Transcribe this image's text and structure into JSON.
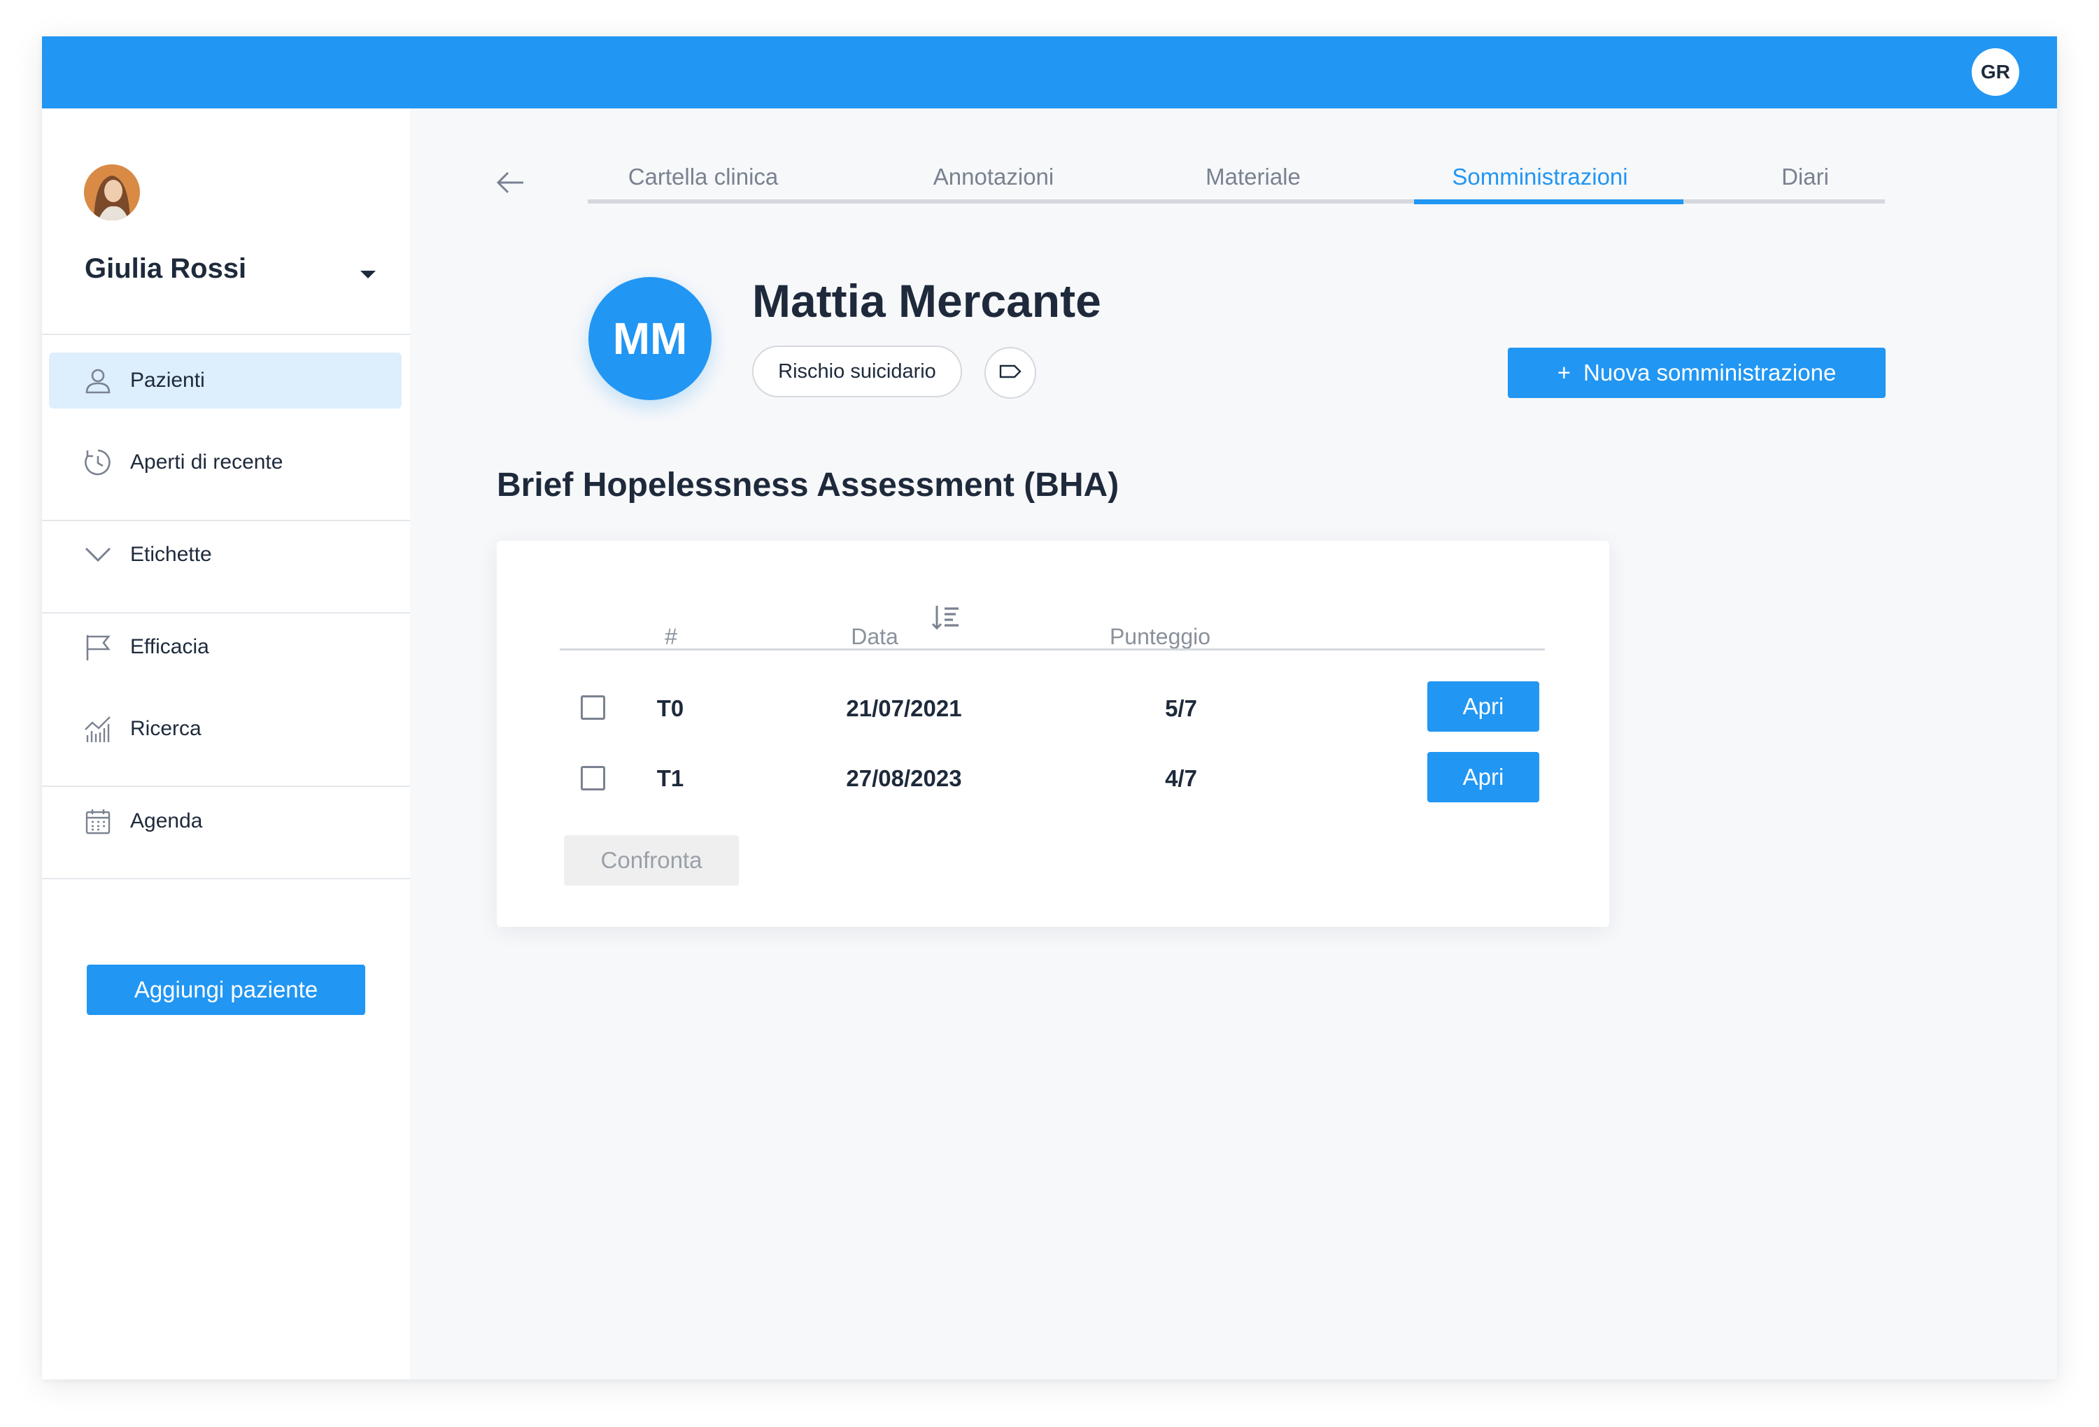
{
  "header": {
    "user_initials": "GR",
    "bar_color": "#2196f3"
  },
  "sidebar": {
    "user_name": "Giulia Rossi",
    "items": [
      {
        "label": "Pazienti",
        "icon": "user-icon",
        "active": true
      },
      {
        "label": "Aperti di recente",
        "icon": "history-icon",
        "active": false
      },
      {
        "label": "Etichette",
        "icon": "chevron-down-icon",
        "active": false
      },
      {
        "label": "Efficacia",
        "icon": "flag-icon",
        "active": false
      },
      {
        "label": "Ricerca",
        "icon": "chart-icon",
        "active": false
      },
      {
        "label": "Agenda",
        "icon": "calendar-icon",
        "active": false
      }
    ],
    "add_patient_label": "Aggiungi paziente"
  },
  "tabs": [
    {
      "label": "Cartella clinica",
      "active": false
    },
    {
      "label": "Annotazioni",
      "active": false
    },
    {
      "label": "Materiale",
      "active": false
    },
    {
      "label": "Somministrazioni",
      "active": true
    },
    {
      "label": "Diari",
      "active": false
    }
  ],
  "patient": {
    "initials": "MM",
    "name": "Mattia Mercante",
    "tag": "Rischio suicidario"
  },
  "actions": {
    "new_admin_plus": "+",
    "new_admin_label": "Nuova somministrazione"
  },
  "assessment": {
    "title": "Brief Hopelessness Assessment (BHA)",
    "columns": {
      "index": "#",
      "date": "Data",
      "score": "Punteggio"
    },
    "rows": [
      {
        "id": "T0",
        "date": "21/07/2021",
        "score": "5/7",
        "action": "Apri"
      },
      {
        "id": "T1",
        "date": "27/08/2023",
        "score": "4/7",
        "action": "Apri"
      }
    ],
    "compare_label": "Confronta"
  }
}
